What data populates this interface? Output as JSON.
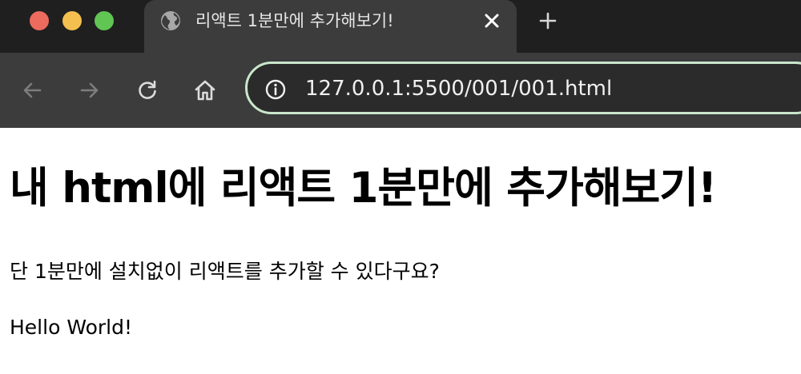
{
  "browser": {
    "tab": {
      "title": "리액트 1분만에 추가해보기!",
      "favicon": "globe-icon",
      "close_icon": "close-icon"
    },
    "new_tab_icon": "plus-icon",
    "toolbar": {
      "back_icon": "back-arrow-icon",
      "forward_icon": "forward-arrow-icon",
      "reload_icon": "reload-icon",
      "home_icon": "home-icon",
      "site_info_icon": "info-icon",
      "url": "127.0.0.1:5500/001/001.html"
    },
    "colors": {
      "tabstrip_bg": "#1f1f1f",
      "toolbar_bg": "#3c3c3c",
      "omnibox_border": "#c9e7cc",
      "traffic_red": "#ed6a5e",
      "traffic_yellow": "#f5bf4f",
      "traffic_green": "#61c554"
    }
  },
  "page": {
    "heading": "내 html에 리액트 1분만에 추가해보기!",
    "description": "단 1분만에 설치없이 리액트를 추가할 수 있다구요?",
    "react_output": "Hello World!"
  }
}
